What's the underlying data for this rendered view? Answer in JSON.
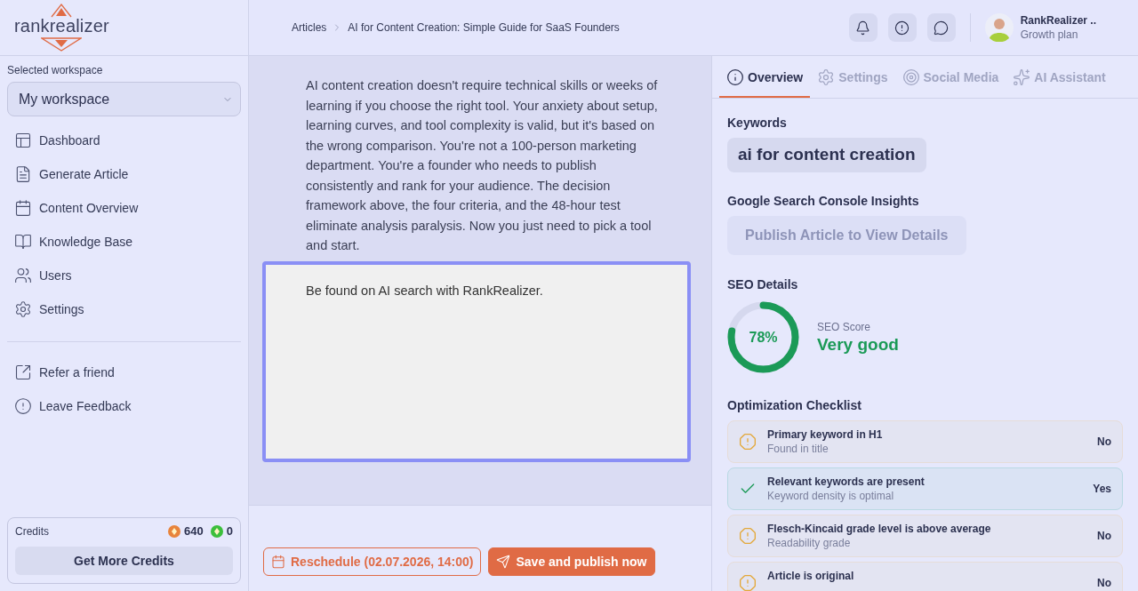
{
  "sidebar": {
    "logo": "rankrealizer",
    "workspace_label": "Selected workspace",
    "workspace": {
      "value": "My workspace"
    },
    "nav_items": [
      {
        "label": "Dashboard"
      },
      {
        "label": "Generate Article"
      },
      {
        "label": "Content Overview"
      },
      {
        "label": "Knowledge Base"
      },
      {
        "label": "Users"
      },
      {
        "label": "Settings"
      }
    ],
    "secondary_items": [
      {
        "label": "Refer a friend"
      },
      {
        "label": "Leave Feedback"
      }
    ],
    "credits": {
      "label": "Credits",
      "balances": [
        {
          "value": "640",
          "color": "#e8843c"
        },
        {
          "value": "0",
          "color": "#3cbf3c"
        }
      ],
      "button": "Get More Credits"
    }
  },
  "header": {
    "breadcrumbs": [
      "Articles",
      "AI for Content Creation: Simple Guide for SaaS Founders"
    ],
    "user": {
      "name": "RankRealizer ..",
      "plan": "Growth plan"
    }
  },
  "article": {
    "paragraphs": [
      "AI content creation doesn't require technical skills or weeks of learning if you choose the right tool. Your anxiety about setup, learning curves, and tool complexity is valid, but it's based on the wrong comparison. You're not a 100-person marketing department. You're a founder who needs to publish consistently and rank for your audience. The decision framework above, the four criteria, and the 48-hour test eliminate analysis paralysis. Now you just need to pick a tool and start."
    ],
    "selected_block": {
      "text": "Be found on AI search with RankRealizer."
    }
  },
  "footer": {
    "buttons": [
      {
        "kind": "outline",
        "label": "Reschedule (02.07.2026, 14:00)"
      },
      {
        "kind": "primary",
        "label": "Save and publish now"
      }
    ]
  },
  "panel": {
    "tabs": [
      {
        "label": "Overview",
        "selected": true
      },
      {
        "label": "Settings",
        "selected": false
      },
      {
        "label": "Social Media",
        "selected": false
      },
      {
        "label": "AI Assistant",
        "selected": false
      }
    ],
    "keywords": {
      "title": "Keywords",
      "items": [
        "ai for content creation"
      ]
    },
    "gsc": {
      "title": "Google Search Console Insights",
      "button": {
        "label": "Publish Article to View Details",
        "disabled": true
      }
    },
    "seo": {
      "title": "SEO Details",
      "score": "78%",
      "level": 0.78,
      "score_label": "SEO Score",
      "rating": "Very good"
    },
    "checklist": {
      "title": "Optimization Checklist",
      "items": [
        {
          "title": "Primary keyword in H1",
          "detail": "Found in title",
          "passed": false,
          "result": "No"
        },
        {
          "title": "Relevant keywords are present",
          "detail": "Keyword density is optimal",
          "passed": true,
          "result": "Yes"
        },
        {
          "title": "Flesch-Kincaid grade level is above average",
          "detail": "Readability grade",
          "passed": false,
          "result": "No"
        },
        {
          "title": "Article is original",
          "passed": false,
          "result": "No"
        }
      ]
    }
  }
}
